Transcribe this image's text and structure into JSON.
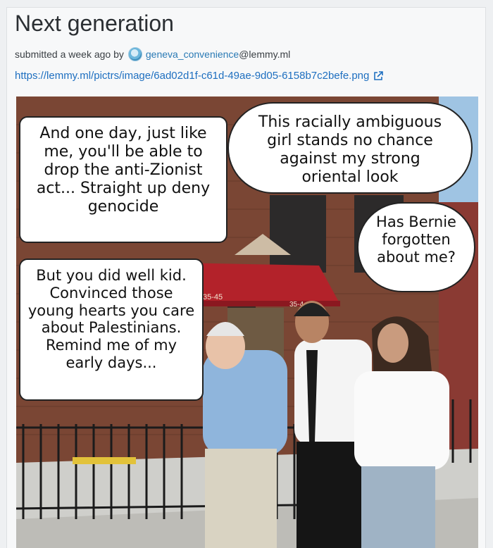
{
  "post": {
    "title": "Next generation",
    "meta_prefix": "submitted a week ago by",
    "user_name": "geneva_convenience",
    "user_instance": "@lemmy.ml",
    "link_url": "https://lemmy.ml/pictrs/image/6ad02d1f-c61d-49ae-9d05-6158b7c2befe.png",
    "icons": {
      "avatar": "user-avatar-icon",
      "external": "external-link-icon"
    }
  },
  "image": {
    "bubbles": {
      "left_top": "And one day, just like me, you'll be able to drop the anti-Zionist act... Straight up deny genocide",
      "right_top": "This racially ambiguous girl stands no chance against my strong oriental look",
      "right_mid": "Has Bernie forgotten about me?",
      "left_mid": "But you did well kid. Convinced those young hearts you care about Palestinians. Remind me of my early days..."
    },
    "sign_1": "35-45",
    "sign_2": "35-4"
  },
  "colors": {
    "link": "#1e6fc0",
    "user": "#2a7ab5",
    "awning": "#b3222a",
    "brick": "#7b4a37"
  }
}
